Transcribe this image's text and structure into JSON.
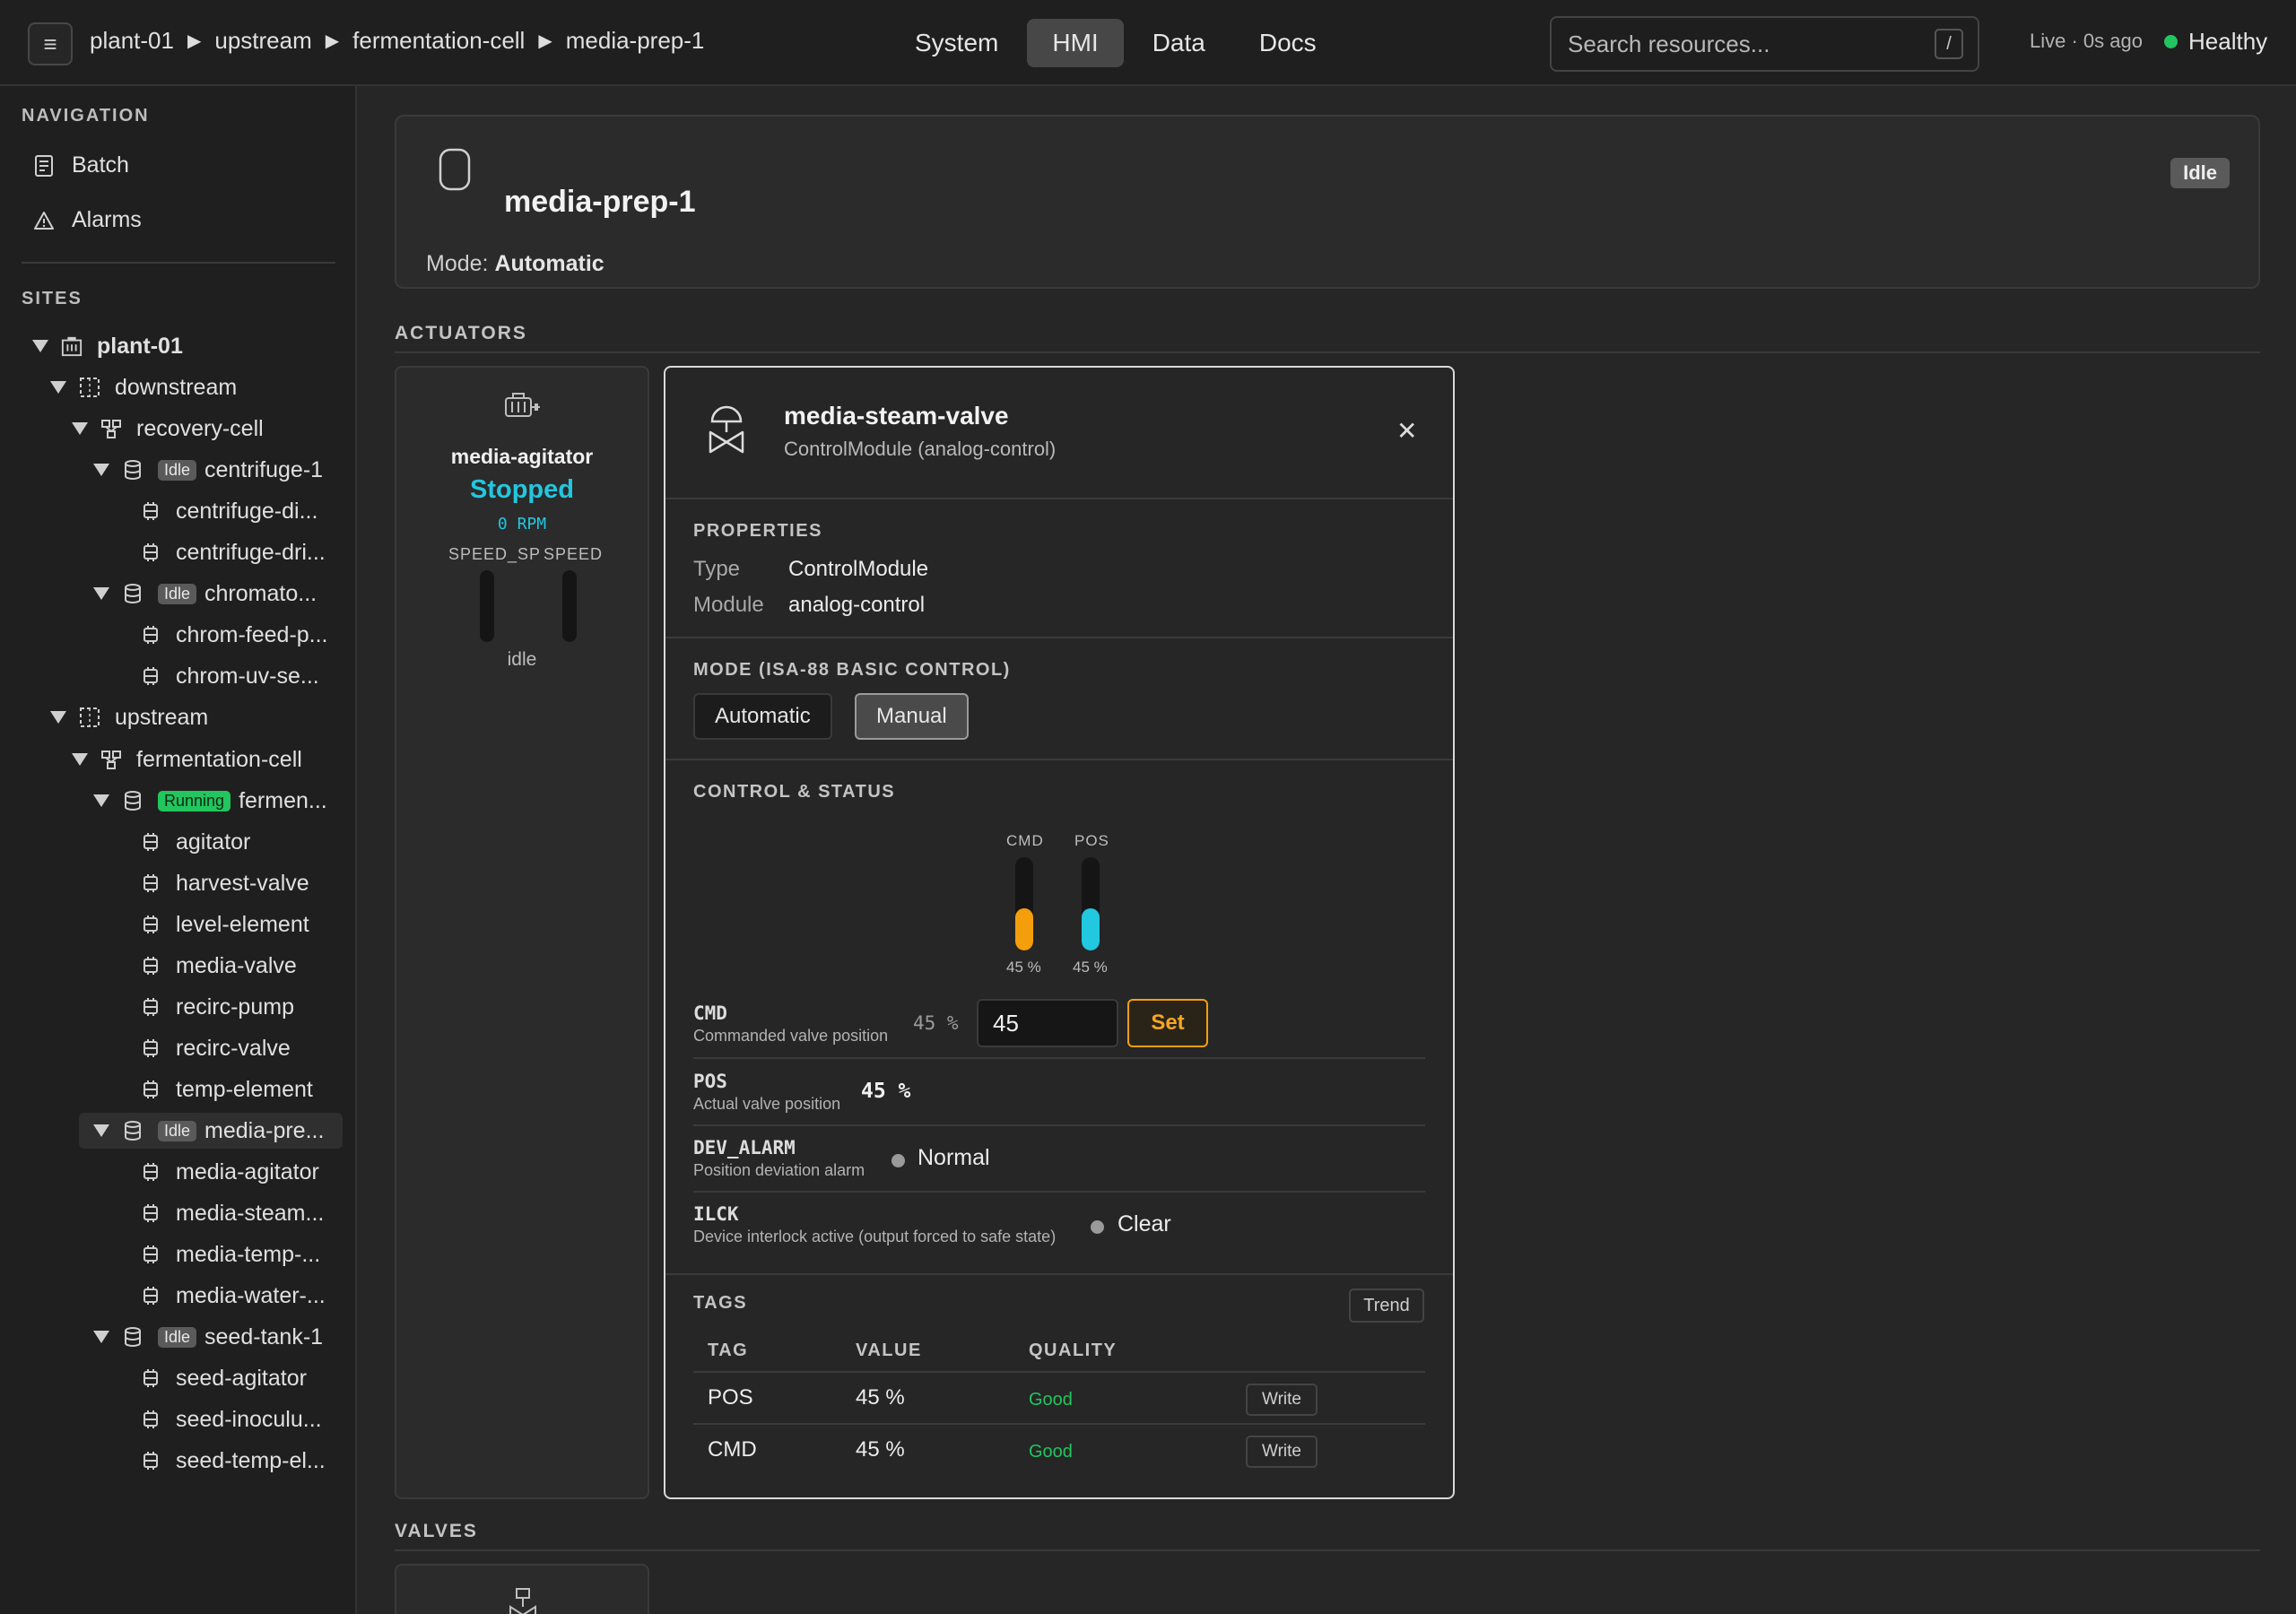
{
  "topbar": {
    "menu_icon": "menu-icon",
    "breadcrumb": [
      "plant-01",
      "upstream",
      "fermentation-cell",
      "media-prep-1"
    ],
    "breadcrumb_separator": "▶",
    "nav": [
      {
        "label": "System",
        "active": false
      },
      {
        "label": "HMI",
        "active": true
      },
      {
        "label": "Data",
        "active": false
      },
      {
        "label": "Docs",
        "active": false
      }
    ],
    "search": {
      "placeholder": "Search resources...",
      "shortcut": "/"
    },
    "live_status": "Live · 0s ago",
    "health": {
      "label": "Healthy",
      "color": "#22c55e"
    }
  },
  "sidebar": {
    "nav_heading": "NAVIGATION",
    "nav_items": [
      {
        "label": "Batch",
        "icon": "batch-icon"
      },
      {
        "label": "Alarms",
        "icon": "alarm-icon"
      }
    ],
    "sites_heading": "SITES",
    "tree": [
      {
        "label": "plant-01",
        "kind": "site",
        "bold": true
      },
      {
        "label": "downstream",
        "kind": "area"
      },
      {
        "label": "recovery-cell",
        "kind": "cell"
      },
      {
        "label": "centrifuge-1",
        "kind": "unit",
        "badge": "Idle"
      },
      {
        "label": "centrifuge-di...",
        "kind": "module"
      },
      {
        "label": "centrifuge-dri...",
        "kind": "module"
      },
      {
        "label": "chromato...",
        "kind": "unit",
        "badge": "Idle"
      },
      {
        "label": "chrom-feed-p...",
        "kind": "module"
      },
      {
        "label": "chrom-uv-se...",
        "kind": "module"
      },
      {
        "label": "upstream",
        "kind": "area"
      },
      {
        "label": "fermentation-cell",
        "kind": "cell"
      },
      {
        "label": "fermen...",
        "kind": "unit",
        "badge": "Running"
      },
      {
        "label": "agitator",
        "kind": "module"
      },
      {
        "label": "harvest-valve",
        "kind": "module"
      },
      {
        "label": "level-element",
        "kind": "module"
      },
      {
        "label": "media-valve",
        "kind": "module"
      },
      {
        "label": "recirc-pump",
        "kind": "module"
      },
      {
        "label": "recirc-valve",
        "kind": "module"
      },
      {
        "label": "temp-element",
        "kind": "module"
      },
      {
        "label": "media-pre...",
        "kind": "unit",
        "badge": "Idle",
        "selected": true
      },
      {
        "label": "media-agitator",
        "kind": "module"
      },
      {
        "label": "media-steam...",
        "kind": "module"
      },
      {
        "label": "media-temp-...",
        "kind": "module"
      },
      {
        "label": "media-water-...",
        "kind": "module"
      },
      {
        "label": "seed-tank-1",
        "kind": "unit",
        "badge": "Idle"
      },
      {
        "label": "seed-agitator",
        "kind": "module"
      },
      {
        "label": "seed-inoculu...",
        "kind": "module"
      },
      {
        "label": "seed-temp-el...",
        "kind": "module"
      }
    ]
  },
  "unit": {
    "name": "media-prep-1",
    "mode_label": "Mode:",
    "mode_value": "Automatic",
    "state_badge": "Idle"
  },
  "sections": {
    "actuators": "ACTUATORS",
    "valves": "VALVES"
  },
  "actuator_card": {
    "name": "media-agitator",
    "state": "Stopped",
    "state_color": "#22c7e0",
    "rpm": "0 RPM",
    "bar_labels": [
      "SPEED_SP",
      "SPEED"
    ],
    "footer": "idle"
  },
  "panel": {
    "title": "media-steam-valve",
    "subtitle": "ControlModule (analog-control)",
    "close_icon": "close-icon",
    "properties_heading": "PROPERTIES",
    "properties": [
      {
        "key": "Type",
        "value": "ControlModule"
      },
      {
        "key": "Module",
        "value": "analog-control"
      }
    ],
    "mode_heading": "MODE (ISA-88 BASIC CONTROL)",
    "mode_buttons": [
      {
        "label": "Automatic",
        "active": false
      },
      {
        "label": "Manual",
        "active": true
      }
    ],
    "control_heading": "CONTROL & STATUS",
    "gauges": [
      {
        "label": "CMD",
        "value_text": "45 %",
        "fraction": 0.45,
        "color": "#f59e0b"
      },
      {
        "label": "POS",
        "value_text": "45 %",
        "fraction": 0.45,
        "color": "#22c7e0"
      }
    ],
    "rows": {
      "cmd": {
        "key": "CMD",
        "desc": "Commanded valve position",
        "current": "45 %",
        "input_value": "45",
        "button": "Set"
      },
      "pos": {
        "key": "POS",
        "desc": "Actual valve position",
        "value": "45 %"
      },
      "dev_alarm": {
        "key": "DEV_ALARM",
        "desc": "Position deviation alarm",
        "status": "Normal"
      },
      "ilck": {
        "key": "ILCK",
        "desc": "Device interlock active (output forced to safe state)",
        "status": "Clear"
      }
    },
    "tags_heading": "TAGS",
    "trend_button": "Trend",
    "tags_columns": [
      "TAG",
      "VALUE",
      "QUALITY"
    ],
    "tags": [
      {
        "tag": "POS",
        "value": "45 %",
        "quality": "Good",
        "action": "Write"
      },
      {
        "tag": "CMD",
        "value": "45 %",
        "quality": "Good",
        "action": "Write"
      }
    ]
  }
}
